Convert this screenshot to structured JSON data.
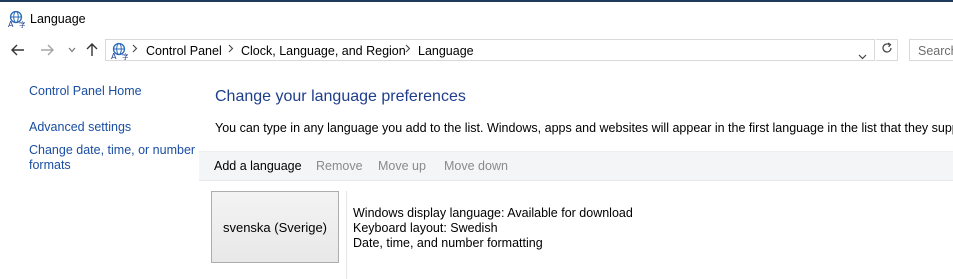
{
  "window": {
    "title": "Language",
    "icon": "language-globe-icon"
  },
  "nav": {
    "back_icon": "back-arrow-icon",
    "forward_icon": "forward-arrow-icon",
    "recent_icon": "chevron-down-icon",
    "up_icon": "up-arrow-icon"
  },
  "address": {
    "breadcrumbs": [
      "Control Panel",
      "Clock, Language, and Region",
      "Language"
    ],
    "separator": ">",
    "dropdown_icon": "chevron-down-icon",
    "refresh_icon": "refresh-icon"
  },
  "search": {
    "placeholder": "Search"
  },
  "sidebar": {
    "home": "Control Panel Home",
    "links": [
      "Advanced settings",
      "Change date, time, or number",
      "formats"
    ]
  },
  "main": {
    "title": "Change your language preferences",
    "description": "You can type in any language you add to the list. Windows, apps and websites will appear in the first language in the list that they support.",
    "toolbar": [
      {
        "label": "Add a language",
        "enabled": true
      },
      {
        "label": "Remove",
        "enabled": false
      },
      {
        "label": "Move up",
        "enabled": false
      },
      {
        "label": "Move down",
        "enabled": false
      }
    ],
    "languages": [
      {
        "name": "svenska (Sverige)",
        "details": [
          "Windows display language: Available for download",
          "Keyboard layout: Swedish",
          "Date, time, and number formatting"
        ]
      }
    ]
  },
  "colors": {
    "link": "#1a4ea2",
    "title": "#1e3e8c",
    "disabled": "#8a8a8a",
    "toolbar_bg": "#f4f5f7"
  }
}
